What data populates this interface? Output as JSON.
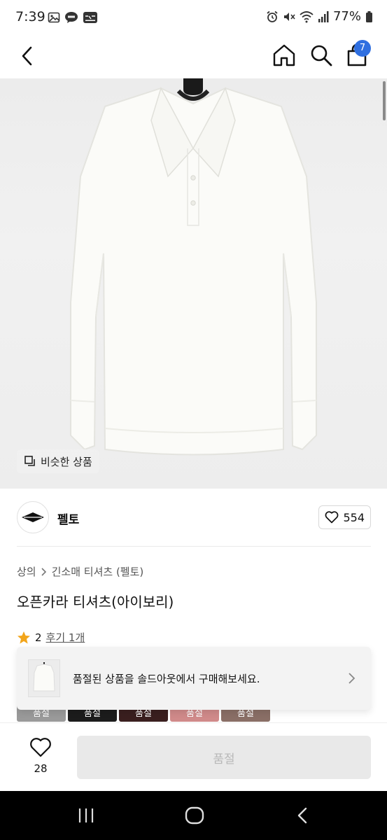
{
  "status_bar": {
    "time": "7:39",
    "battery": "77%",
    "left_icons": [
      "gallery-icon",
      "kakaotalk-icon",
      "kia-connect-icon"
    ],
    "right_icons": [
      "alarm-icon",
      "mute-icon",
      "wifi-icon",
      "signal-icon",
      "battery-icon"
    ]
  },
  "nav": {
    "icons": [
      "back-icon",
      "home-icon",
      "search-icon",
      "cart-icon"
    ],
    "cart_badge": "7"
  },
  "hero": {
    "similar_label": "비슷한 상품"
  },
  "shop": {
    "name": "펠토",
    "likes": "554"
  },
  "breadcrumb": {
    "category": "상의",
    "subcategory": "긴소매 티셔츠 (펠토)"
  },
  "product": {
    "title": "오픈카라 티셔츠(아이보리)"
  },
  "rating": {
    "score": "2",
    "review_link": "후기 1개"
  },
  "swatches": [
    {
      "label": "품절",
      "color": "#9a9a9a"
    },
    {
      "label": "품절",
      "color": "#1c1c1c"
    },
    {
      "label": "품절",
      "color": "#3a1f1f"
    },
    {
      "label": "품절",
      "color": "#d08a8a"
    },
    {
      "label": "품절",
      "color": "#8a6f66"
    }
  ],
  "soldout_banner": {
    "text": "품절된 상품을 솔드아웃에서 구매해보세요."
  },
  "bottom_bar": {
    "wish_count": "28",
    "buy_label": "품절"
  },
  "colors": {
    "badge_blue": "#2f6fe0",
    "star_orange": "#f2a51a",
    "disabled_gray": "#e9e9e9"
  }
}
